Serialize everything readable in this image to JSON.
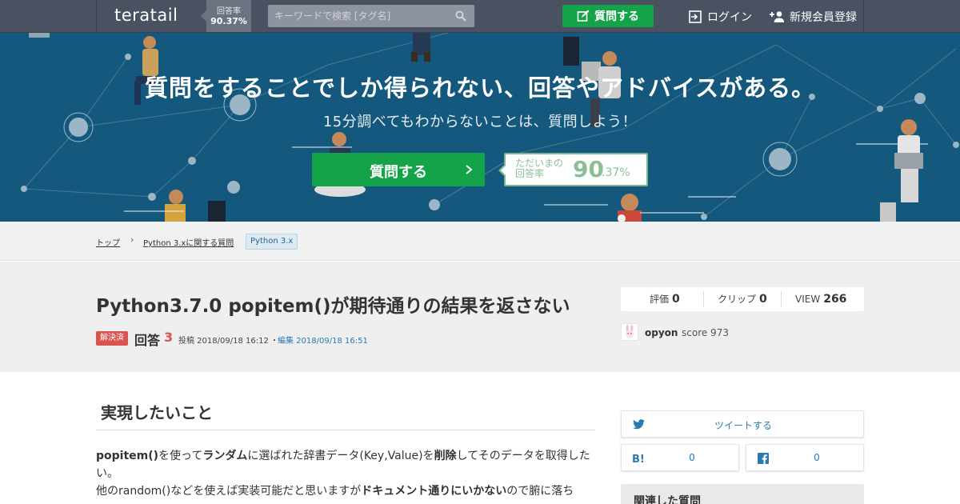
{
  "header": {
    "logo": "teratail",
    "rate_label": "回答率",
    "rate_value": "90.37%",
    "search_placeholder": "キーワードで検索 [タグ名]",
    "ask_label": "質問する",
    "login_label": "ログイン",
    "signup_label": "新規会員登録"
  },
  "hero": {
    "title": "質問をすることでしか得られない、回答やアドバイスがある。",
    "subtitle": "15分調べてもわからないことは、質問しよう！",
    "ask_label": "質問する",
    "rate_caption_1": "ただいまの",
    "rate_caption_2": "回答率",
    "rate_big": "90",
    "rate_small": ".37%"
  },
  "breadcrumb": {
    "items": [
      "トップ",
      "Python 3.xに関する質問"
    ],
    "separator": "›",
    "tag": "Python 3.x"
  },
  "question": {
    "title": "Python3.7.0 popitem()が期待通りの結果を返さない",
    "solved_badge": "解決済",
    "answers_label": "回答",
    "answers_count": "3",
    "posted": "投稿 2018/09/18 16:12",
    "edited_sep": "・",
    "edited": "編集 2018/09/18 16:51",
    "stats": {
      "rating_label": "評価",
      "rating_value": "0",
      "clip_label": "クリップ",
      "clip_value": "0",
      "view_label": "VIEW",
      "view_value": "266"
    },
    "author": {
      "name": "opyon",
      "score": "score 973"
    }
  },
  "body": {
    "heading": "実現したいこと",
    "p1_a": "popitem()",
    "p1_b": "を使って",
    "p1_c": "ランダム",
    "p1_d": "に選ばれた辞書データ(Key,Value)を",
    "p1_e": "削除",
    "p1_f": "してそのデータを取得した",
    "p1_g": "い。",
    "p2_a": "他のrandom()などを使えば実装可能だと思いますが",
    "p2_b": "ドキュメント通りにいかない",
    "p2_c": "ので腑に落ち"
  },
  "sidebar": {
    "tweet_label": "ツイートする",
    "hatena_count": "0",
    "facebook_count": "0",
    "related_title": "関連した質問"
  },
  "colors": {
    "nav": "#4a5160",
    "hero": "#15587d",
    "accent_green": "#15a34a",
    "solved_red": "#d9534f",
    "link_blue": "#2a7ab0"
  }
}
